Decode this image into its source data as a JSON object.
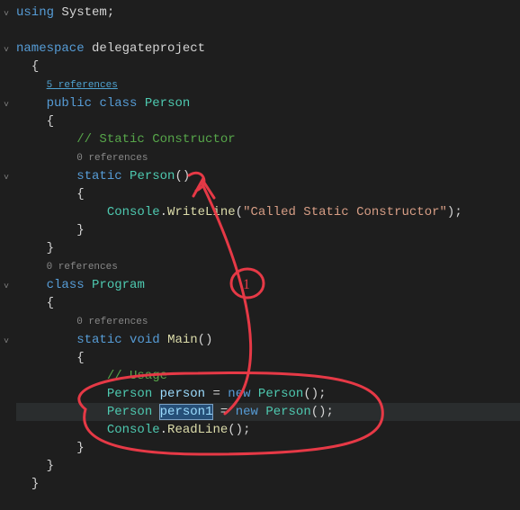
{
  "code": {
    "l1_kw": "using",
    "l1_ns": "System",
    "l1_sc": ";",
    "l3_kw": "namespace",
    "l3_name": "delegateproject",
    "brace_open": "{",
    "brace_close": "}",
    "refs5": "5 references",
    "l6_pub": "public",
    "l6_cls": "class",
    "l6_name": "Person",
    "cmt_static": "// Static Constructor",
    "refs0_a": "0 references",
    "l10_kw": "static",
    "l10_name": "Person",
    "l10_par": "()",
    "l12_obj": "Console",
    "l12_dot": ".",
    "l12_meth": "WriteLine",
    "l12_lp": "(",
    "l12_str": "\"Called Static Constructor\"",
    "l12_rp": ");",
    "refs0_b": "0 references",
    "l16_cls": "class",
    "l16_name": "Program",
    "refs0_c": "0 references",
    "l19_static": "static",
    "l19_void": "void",
    "l19_main": "Main",
    "l19_par": "()",
    "cmt_usage": "// Usage",
    "l22_t": "Person",
    "l22_v": "person",
    "l22_eq": " = ",
    "l22_new": "new",
    "l22_ctor": "Person",
    "l22_end": "();",
    "l23_t": "Person",
    "l23_v": "person1",
    "l23_eq": " = ",
    "l23_new": "new",
    "l23_ctor": "Person",
    "l23_end": "();",
    "l24_obj": "Console",
    "l24_dot": ".",
    "l24_meth": "ReadLine",
    "l24_end": "();"
  },
  "fold_glyph": "˅",
  "annotations": {
    "circle1_label": "1",
    "color": "#e63946"
  }
}
